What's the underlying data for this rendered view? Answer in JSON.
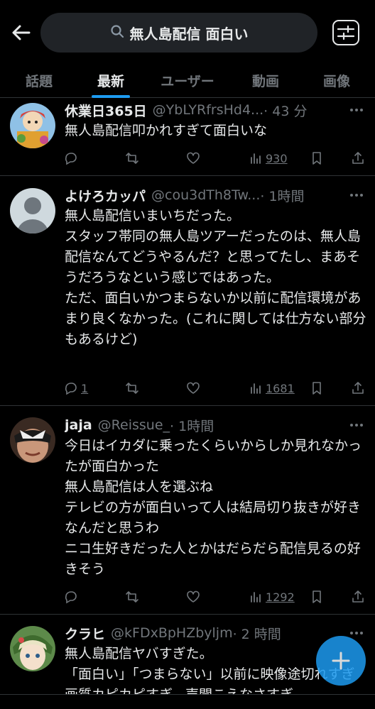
{
  "search": {
    "query": "無人島配信 面白い"
  },
  "tabs": [
    {
      "label": "話題"
    },
    {
      "label": "最新"
    },
    {
      "label": "ユーザー"
    },
    {
      "label": "動画"
    },
    {
      "label": "画像"
    }
  ],
  "active_tab": "最新",
  "accent_color": "#1d9bf0",
  "tweets": [
    {
      "name": "休業日365日",
      "handle": "@YbLYRfrsHd4...",
      "time": "· 43 分",
      "text": "無人島配信叩かれすぎて面白いな",
      "replies": "",
      "retweets": "",
      "likes": "",
      "views": "930"
    },
    {
      "name": "よけろカッパ",
      "handle": "@cou3dTh8Tw...",
      "time": "· 1時間",
      "text": "無人島配信いまいちだった。\nスタッフ帯同の無人島ツアーだったのは、無人島配信なんてどうやるんだ？と思ってたし、まあそうだろうなという感じではあった。\nただ、面白いかつまらないか以前に配信環境があまり良くなかった。(これに関しては仕方ない部分もあるけど)",
      "replies": "1",
      "retweets": "",
      "likes": "",
      "views": "1681"
    },
    {
      "name": "jaja",
      "handle": "@Reissue_",
      "time": "· 1時間",
      "text": "今日はイカダに乗ったくらいからしか見れなかったが面白かった\n無人島配信は人を選ぶね\nテレビの方が面白いって人は結局切り抜きが好きなんだと思うわ\nニコ生好きだった人とかはだらだら配信見るの好きそう",
      "replies": "",
      "retweets": "",
      "likes": "",
      "views": "1292"
    },
    {
      "name": "クラヒ",
      "handle": "@kFDxBpHZbyljm",
      "time": "· 2 時間",
      "text": "無人島配信ヤバすぎた。\n「面白い」「つまらない」以前に映像途切れすぎ画質カピカピすぎ、声聞こえなさすぎ。",
      "replies": "",
      "retweets": "",
      "likes": "",
      "views": ""
    }
  ]
}
